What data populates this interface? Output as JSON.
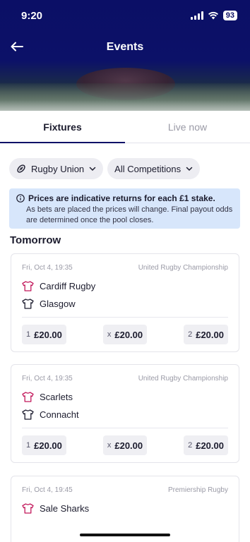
{
  "status": {
    "time": "9:20",
    "battery": "93"
  },
  "header": {
    "title": "Events"
  },
  "tabs": [
    {
      "label": "Fixtures",
      "active": true
    },
    {
      "label": "Live now",
      "active": false
    }
  ],
  "filters": {
    "sport": {
      "label": "Rugby Union",
      "icon": "rugby-ball-icon"
    },
    "competition": {
      "label": "All Competitions"
    }
  },
  "info": {
    "bold": "Prices are indicative returns for each £1 stake.",
    "body": "As bets are placed the prices will change. Final payout odds are determined once the pool closes."
  },
  "section_title": "Tomorrow",
  "colors": {
    "brand": "#0c1168",
    "home_shirt": "#c2185b",
    "away_shirt": "#1c1c2e",
    "info_bg": "#d7e6fb"
  },
  "events": [
    {
      "datetime": "Fri, Oct 4, 19:35",
      "competition": "United Rugby Championship",
      "home": "Cardiff Rugby",
      "away": "Glasgow",
      "odds": [
        {
          "key": "1",
          "value": "£20.00"
        },
        {
          "key": "x",
          "value": "£20.00"
        },
        {
          "key": "2",
          "value": "£20.00"
        }
      ]
    },
    {
      "datetime": "Fri, Oct 4, 19:35",
      "competition": "United Rugby Championship",
      "home": "Scarlets",
      "away": "Connacht",
      "odds": [
        {
          "key": "1",
          "value": "£20.00"
        },
        {
          "key": "x",
          "value": "£20.00"
        },
        {
          "key": "2",
          "value": "£20.00"
        }
      ]
    },
    {
      "datetime": "Fri, Oct 4, 19:45",
      "competition": "Premiership Rugby",
      "home": "Sale Sharks"
    }
  ]
}
